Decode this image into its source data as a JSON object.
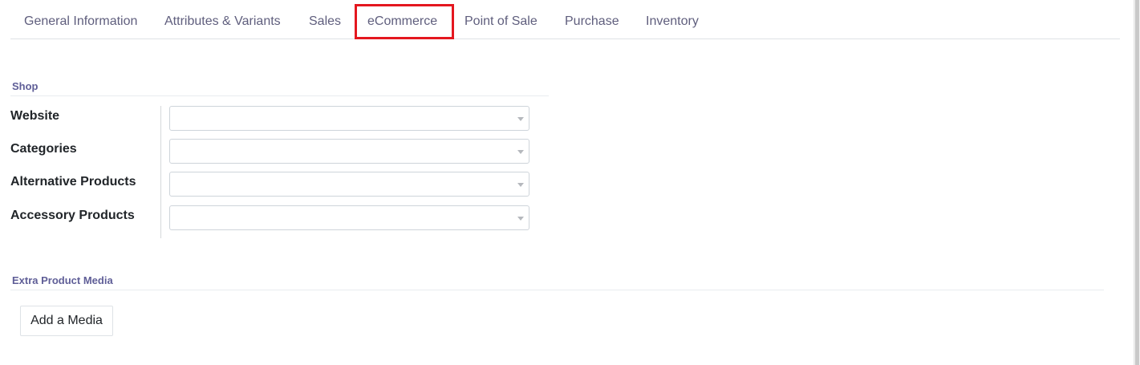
{
  "tabs": [
    {
      "label": "General Information"
    },
    {
      "label": "Attributes & Variants"
    },
    {
      "label": "Sales"
    },
    {
      "label": "eCommerce",
      "active": true,
      "highlight_color": "#e4171f"
    },
    {
      "label": "Point of Sale"
    },
    {
      "label": "Purchase"
    },
    {
      "label": "Inventory"
    }
  ],
  "shop": {
    "title": "Shop",
    "fields": [
      {
        "label": "Website",
        "value": ""
      },
      {
        "label": "Categories",
        "value": ""
      },
      {
        "label": "Alternative Products",
        "value": ""
      },
      {
        "label": "Accessory Products",
        "value": ""
      }
    ]
  },
  "media": {
    "title": "Extra Product Media",
    "add_button_label": "Add a Media"
  },
  "colors": {
    "accent_text": "#5f5e97",
    "tab_text": "#5f5e7d",
    "highlight": "#e4171f"
  },
  "icons": {
    "select_caret": "chevron-down-icon"
  }
}
